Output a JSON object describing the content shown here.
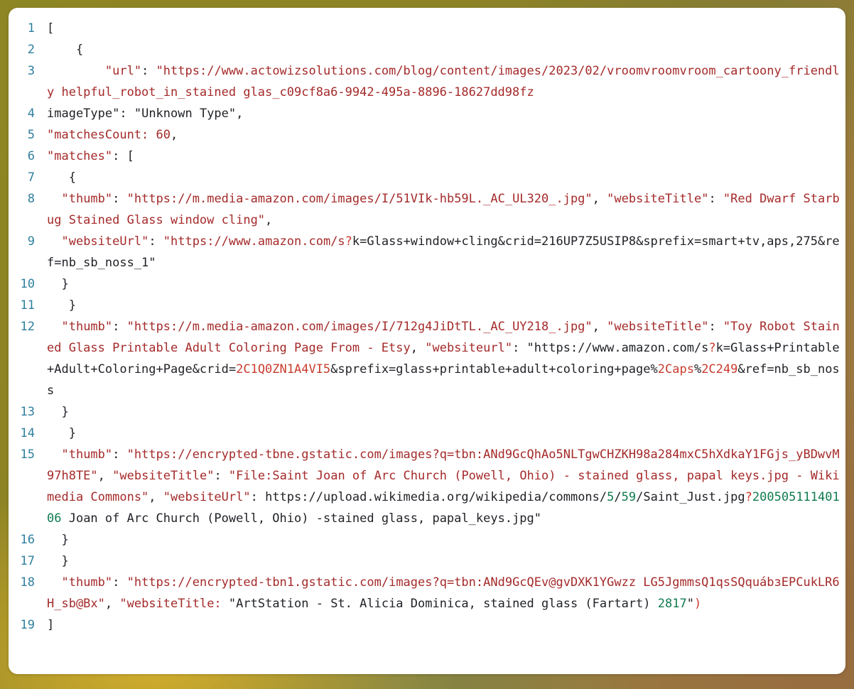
{
  "window": {
    "kind": "code-viewer-screenshot",
    "background_color": "#8e8524",
    "card_color": "#ffffff",
    "line_number_color": "#2f7f9e",
    "string_color": "#a52a2a",
    "number_color": "#0f7b4f",
    "plain_color": "#1f2126"
  },
  "code": {
    "language": "json",
    "first_line_number": 1,
    "last_line_number": 19,
    "lines": [
      {
        "n": "1",
        "segments": [
          {
            "t": "[",
            "c": "plain"
          }
        ]
      },
      {
        "n": "2",
        "segments": [
          {
            "t": "    {",
            "c": "plain"
          }
        ]
      },
      {
        "n": "3",
        "segments": [
          {
            "t": "        ",
            "c": "plain"
          },
          {
            "t": "\"url\"",
            "c": "str"
          },
          {
            "t": ": ",
            "c": "plain"
          },
          {
            "t": "\"https://www.actowizsolutions.com/blog/content/images/2023/02/vroomvroomvroom_cartoony_friendly helpful_robot_in_stained glas_c09cf8a6-9942-495a-8896-18627dd98fz",
            "c": "str"
          }
        ]
      },
      {
        "n": "4",
        "segments": [
          {
            "t": "imageType\"",
            "c": "plain"
          },
          {
            "t": ": ",
            "c": "plain"
          },
          {
            "t": "\"Unknown Type\"",
            "c": "plain"
          },
          {
            "t": ",",
            "c": "plain"
          }
        ]
      },
      {
        "n": "5",
        "segments": [
          {
            "t": "\"matchesCount: 60",
            "c": "str"
          },
          {
            "t": ",",
            "c": "plain"
          }
        ]
      },
      {
        "n": "6",
        "segments": [
          {
            "t": "\"matches\"",
            "c": "str"
          },
          {
            "t": ": [",
            "c": "plain"
          }
        ]
      },
      {
        "n": "7",
        "segments": [
          {
            "t": "   {",
            "c": "plain"
          }
        ]
      },
      {
        "n": "8",
        "segments": [
          {
            "t": "  ",
            "c": "plain"
          },
          {
            "t": "\"thumb\"",
            "c": "str"
          },
          {
            "t": ": ",
            "c": "plain"
          },
          {
            "t": "\"https://m.media-amazon.com/images/I/51VIk-hb59L._AC_UL320_.jpg\"",
            "c": "str"
          },
          {
            "t": ", ",
            "c": "plain"
          },
          {
            "t": "\"websiteTitle\"",
            "c": "str"
          },
          {
            "t": ": ",
            "c": "plain"
          },
          {
            "t": "\"Red Dwarf Starbug Stained Glass window cling\"",
            "c": "str"
          },
          {
            "t": ",",
            "c": "plain"
          }
        ]
      },
      {
        "n": "9",
        "segments": [
          {
            "t": "  ",
            "c": "plain"
          },
          {
            "t": "\"websiteUrl\"",
            "c": "str"
          },
          {
            "t": ": ",
            "c": "plain"
          },
          {
            "t": "\"https://www.amazon.com/s",
            "c": "str"
          },
          {
            "t": "?",
            "c": "brightred"
          },
          {
            "t": "k=Glass+window+cling&crid=216UP7Z5USIP8&sprefix=smart+tv,aps,275&ref=nb_sb_noss_1\"",
            "c": "plain"
          }
        ]
      },
      {
        "n": "10",
        "segments": [
          {
            "t": "  }",
            "c": "plain"
          }
        ]
      },
      {
        "n": "11",
        "segments": [
          {
            "t": "   }",
            "c": "plain"
          }
        ]
      },
      {
        "n": "12",
        "segments": [
          {
            "t": "  ",
            "c": "plain"
          },
          {
            "t": "\"thumb\"",
            "c": "str"
          },
          {
            "t": ": ",
            "c": "plain"
          },
          {
            "t": "\"https://m.media-amazon.com/images/I/712g4JiDtTL._AC_UY218_.jpg\"",
            "c": "str"
          },
          {
            "t": ", ",
            "c": "plain"
          },
          {
            "t": "\"websiteTitle\"",
            "c": "str"
          },
          {
            "t": ": ",
            "c": "plain"
          },
          {
            "t": "\"Toy Robot Stained Glass Printable Adult Coloring Page From - Etsy",
            "c": "str"
          },
          {
            "t": ", ",
            "c": "plain"
          },
          {
            "t": "\"websiteurl\"",
            "c": "str"
          },
          {
            "t": ": ",
            "c": "plain"
          },
          {
            "t": "\"https://www.amazon.com/s",
            "c": "plain"
          },
          {
            "t": "?",
            "c": "brightred"
          },
          {
            "t": "k=Glass+Printable+Adult+Coloring+Page&crid=",
            "c": "plain"
          },
          {
            "t": "2C1Q0ZN1A4VI5",
            "c": "brightred"
          },
          {
            "t": "&sprefix=glass+printable+adult+coloring+page%",
            "c": "plain"
          },
          {
            "t": "2Caps",
            "c": "brightred"
          },
          {
            "t": "%",
            "c": "plain"
          },
          {
            "t": "2C249",
            "c": "brightred"
          },
          {
            "t": "&ref=nb_sb_noss",
            "c": "plain"
          }
        ]
      },
      {
        "n": "13",
        "segments": [
          {
            "t": "  }",
            "c": "plain"
          }
        ]
      },
      {
        "n": "14",
        "segments": [
          {
            "t": "   }",
            "c": "plain"
          }
        ]
      },
      {
        "n": "15",
        "segments": [
          {
            "t": "  ",
            "c": "plain"
          },
          {
            "t": "\"thumb\"",
            "c": "str"
          },
          {
            "t": ": ",
            "c": "plain"
          },
          {
            "t": "\"https://encrypted-tbne.gstatic.com/images?q=tbn:ANd9GcQhAo5NLTgwCHZKH98a284mxC5hXdkaY1FGjs_yBDwvM97h8TE\"",
            "c": "str"
          },
          {
            "t": ", ",
            "c": "plain"
          },
          {
            "t": "\"websiteTitle\"",
            "c": "str"
          },
          {
            "t": ": ",
            "c": "plain"
          },
          {
            "t": "\"File:Saint Joan of Arc Church (Powell, Ohio) - stained glass, papal keys.jpg - Wikimedia Commons\"",
            "c": "str"
          },
          {
            "t": ", ",
            "c": "plain"
          },
          {
            "t": "\"websiteUrl\"",
            "c": "str"
          },
          {
            "t": ": ",
            "c": "plain"
          },
          {
            "t": "https://upload.wikimedia.org/wikipedia/commons/",
            "c": "plain"
          },
          {
            "t": "5",
            "c": "num"
          },
          {
            "t": "/",
            "c": "plain"
          },
          {
            "t": "59",
            "c": "num"
          },
          {
            "t": "/Saint_Just.jpg",
            "c": "plain"
          },
          {
            "t": "?",
            "c": "brightred"
          },
          {
            "t": "20050511140106",
            "c": "num"
          },
          {
            "t": " Joan of Arc Church (Powell, Ohio) -stained glass, papal_keys.jpg\"",
            "c": "plain"
          }
        ]
      },
      {
        "n": "16",
        "segments": [
          {
            "t": "  }",
            "c": "plain"
          }
        ]
      },
      {
        "n": "17",
        "segments": [
          {
            "t": "  }",
            "c": "plain"
          }
        ]
      },
      {
        "n": "18",
        "segments": [
          {
            "t": "  ",
            "c": "plain"
          },
          {
            "t": "\"thumb\"",
            "c": "str"
          },
          {
            "t": ": ",
            "c": "plain"
          },
          {
            "t": "\"https://encrypted-tbn1.gstatic.com/images?q=tbn:ANd9GcQEv@gvDXK1YGwzz LG5JgmmsQ1qsSQquábзEPCukLR6H_sb@Bx\"",
            "c": "str"
          },
          {
            "t": ", ",
            "c": "plain"
          },
          {
            "t": "\"websiteTitle: ",
            "c": "str"
          },
          {
            "t": "\"ArtStation - St. Alicia Dominica, stained glass (Fartart) ",
            "c": "plain"
          },
          {
            "t": "2817",
            "c": "num"
          },
          {
            "t": "\"",
            "c": "plain"
          },
          {
            "t": ")",
            "c": "brightred"
          }
        ]
      },
      {
        "n": "19",
        "segments": [
          {
            "t": "]",
            "c": "plain"
          }
        ]
      }
    ]
  }
}
